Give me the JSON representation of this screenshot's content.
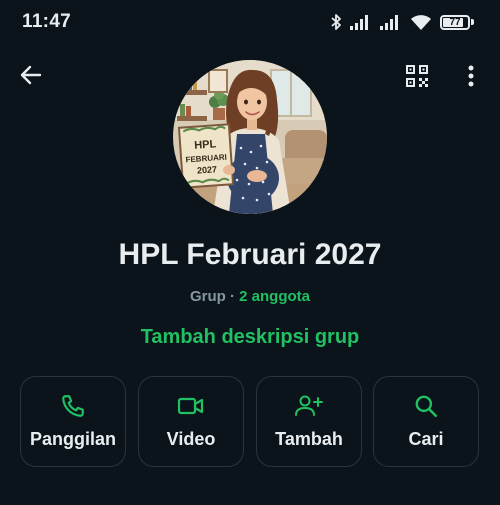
{
  "status_bar": {
    "time": "11:47",
    "battery": "77"
  },
  "header": {
    "back_icon": "arrow-left-icon",
    "qr_icon": "qr-code-icon",
    "more_icon": "more-vertical-icon"
  },
  "avatar": {
    "sign_line1": "HPL",
    "sign_line2": "FEBRUARI",
    "sign_line3": "2027"
  },
  "group": {
    "name": "HPL Februari 2027",
    "type": "Grup",
    "separator": "·",
    "member_count": "2 anggota",
    "add_description": "Tambah deskripsi grup"
  },
  "actions": [
    {
      "label": "Panggilan",
      "icon": "phone-icon"
    },
    {
      "label": "Video",
      "icon": "video-camera-icon"
    },
    {
      "label": "Tambah",
      "icon": "add-person-icon"
    },
    {
      "label": "Cari",
      "icon": "search-icon"
    }
  ],
  "colors": {
    "background": "#0b141a",
    "accent": "#21c063",
    "text": "#e9edef",
    "muted": "#8696a0"
  }
}
